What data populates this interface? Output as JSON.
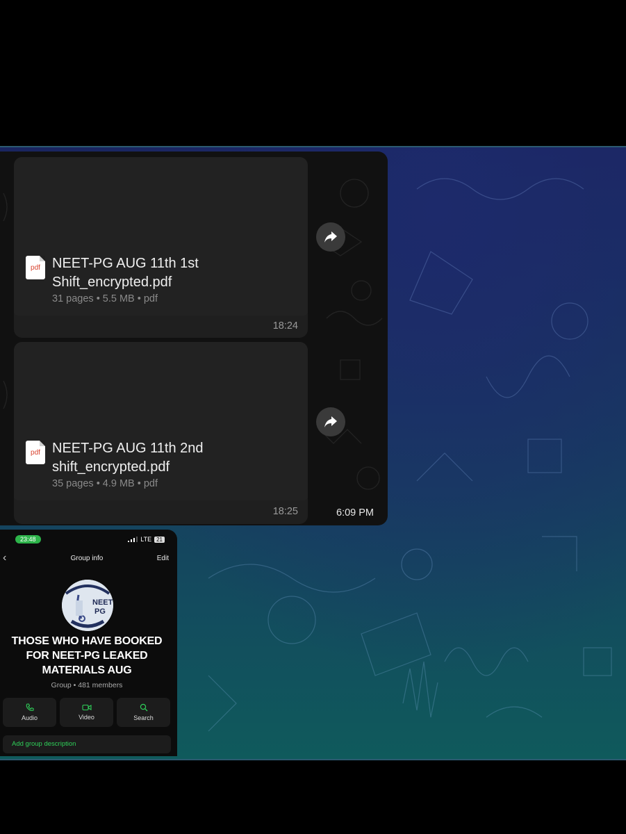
{
  "chat": {
    "messages": [
      {
        "file_name_line1": "NEET-PG AUG 11th 1st",
        "file_name_line2": "Shift_encrypted.pdf",
        "meta": "31 pages • 5.5 MB • pdf",
        "time": "18:24",
        "icon_label": "pdf"
      },
      {
        "file_name_line1": "NEET-PG AUG 11th 2nd",
        "file_name_line2": "shift_encrypted.pdf",
        "meta": "35 pages • 4.9 MB • pdf",
        "time": "18:25",
        "icon_label": "pdf"
      }
    ],
    "panel_time": "6:09 PM"
  },
  "phone": {
    "status_time": "23:48",
    "network": "LTE",
    "battery": "21",
    "title": "Group info",
    "edit_label": "Edit",
    "avatar_text_line1": "NEET",
    "avatar_text_line2": "PG",
    "group_name_line1": "THOSE WHO HAVE BOOKED",
    "group_name_line2": "FOR NEET-PG  LEAKED",
    "group_name_line3": "MATERIALS  AUG",
    "group_meta": "Group • 481 members",
    "actions": [
      {
        "label": "Audio",
        "icon": "phone-icon"
      },
      {
        "label": "Video",
        "icon": "video-icon"
      },
      {
        "label": "Search",
        "icon": "search-icon"
      }
    ],
    "add_description": "Add group description"
  },
  "colors": {
    "accent_green": "#2fcf59",
    "pdf_red": "#d9432f"
  }
}
